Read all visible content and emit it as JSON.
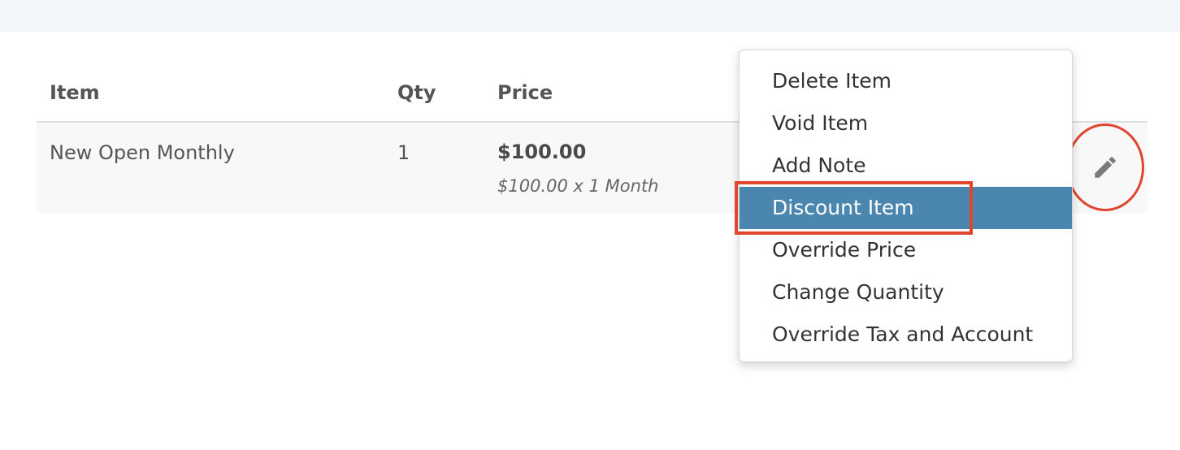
{
  "table": {
    "headers": {
      "item": "Item",
      "qty": "Qty",
      "price": "Price"
    },
    "rows": [
      {
        "name": "New Open Monthly",
        "qty": "1",
        "price": "$100.00",
        "price_detail": "$100.00 x 1 Month"
      }
    ]
  },
  "edit_button": {
    "icon": "pencil-icon",
    "annotation_color": "#e0452e"
  },
  "menu": {
    "items": [
      {
        "label": "Delete Item"
      },
      {
        "label": "Void Item"
      },
      {
        "label": "Add Note"
      },
      {
        "label": "Discount Item",
        "active": true
      },
      {
        "label": "Override Price"
      },
      {
        "label": "Change Quantity"
      },
      {
        "label": "Override Tax and Account"
      }
    ],
    "active_color": "#4a86ad"
  }
}
